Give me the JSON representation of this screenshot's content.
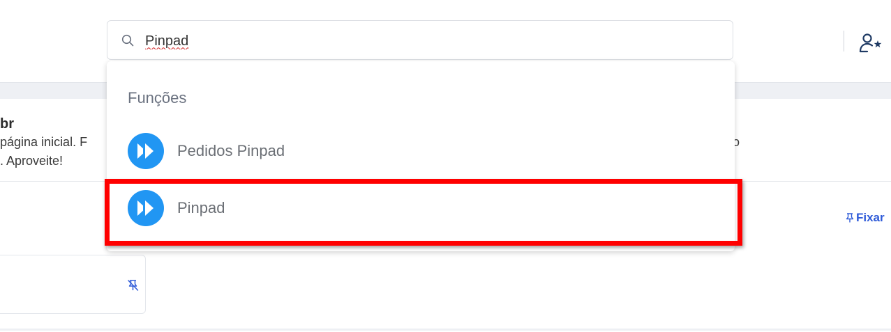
{
  "search": {
    "value": "Pinpad",
    "icon": "search-icon"
  },
  "header": {
    "user_icon": "user-star-icon"
  },
  "banner": {
    "title_fragment": "br",
    "line1_fragment": "página inicial. F",
    "line2_fragment": ". Aproveite!",
    "tail_fragment": "o"
  },
  "pin": {
    "label": "Fixar",
    "icon": "pin-icon"
  },
  "card": {
    "icon": "unpin-icon"
  },
  "dropdown": {
    "section_title": "Funções",
    "results": [
      {
        "label": "Pedidos Pinpad",
        "icon": "fast-forward-icon"
      },
      {
        "label": "Pinpad",
        "icon": "fast-forward-icon",
        "highlighted": true
      }
    ]
  },
  "colors": {
    "accent_blue": "#2196f3",
    "link_blue": "#2f5bd8",
    "highlight_red": "#ff0000"
  }
}
